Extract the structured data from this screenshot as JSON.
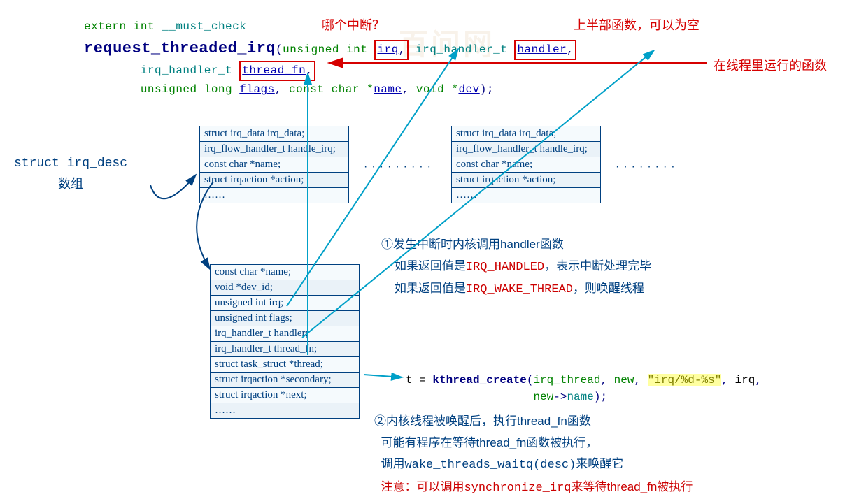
{
  "annotations": {
    "which_irq": "哪个中断？",
    "top_half": "上半部函数，可以为空",
    "thread_run": "在线程里运行的函数"
  },
  "signature": {
    "extern": "extern int",
    "must_check": "__must_check",
    "fn": "request_threaded_irq",
    "p_uint": "unsigned int",
    "p_irq": "irq",
    "p_handler_t": "irq_handler_t",
    "p_handler": "handler",
    "p_thread_fn": "thread_fn",
    "p_ulong": "unsigned long",
    "p_flags": "flags",
    "p_constchar": "const char *",
    "p_name": "name",
    "p_void": "void *",
    "p_dev": "dev"
  },
  "struct_label_line1": "struct irq_desc",
  "struct_label_line2": "数组",
  "table_irq_desc": [
    "struct irq_data irq_data;",
    "irq_flow_handler_t handle_irq;",
    "const char *name;",
    "struct irqaction *action;",
    "……"
  ],
  "table_irq_desc2": [
    "struct irq_data irq_data;",
    "irq_flow_handler_t handle_irq;",
    "const char *name;",
    "struct irqaction *action;",
    "……"
  ],
  "table_action": [
    "const char *name;",
    "void *dev_id;",
    "unsigned int irq;",
    "unsigned int flags;",
    "irq_handler_t handler;",
    "irq_handler_t thread_fn;",
    "struct task_struct *thread;",
    "struct irqaction *secondary;",
    "struct irqaction *next;",
    "……"
  ],
  "explain1": {
    "l1a": "①发生中断时内核调用",
    "l1b": "handler",
    "l1c": "函数",
    "l2a": "如果返回值是",
    "l2_irq_handled": "IRQ_HANDLED",
    "l2b": "，表示中断处理完毕",
    "l3a": "如果返回值是",
    "l3_wake": "IRQ_WAKE_THREAD",
    "l3b": "，则唤醒线程"
  },
  "code_line": {
    "t_eq": "t = ",
    "kthread": "kthread_create",
    "lp": "(",
    "irq_thread": "irq_thread",
    "c1": ", ",
    "new1": "new",
    "c2": ", ",
    "fmt": "\"irq/%d-%s\"",
    "c3": ", ",
    "irq": "irq",
    "c4": ",",
    "new2": "new",
    "arrow": "->",
    "name": "name",
    "rp": ");"
  },
  "explain2": {
    "l1a": "②内核线程被唤醒后，执行",
    "l1b": "thread_fn",
    "l1c": "函数",
    "l2a": "可能有程序在等待",
    "l2b": "thread_fn",
    "l2c": "函数被执行，",
    "l3a": "调用",
    "l3b": "wake_threads_waitq(desc)",
    "l3c": "来唤醒它",
    "l4a": "注意：",
    "l4b": "可以调用",
    "l4c": "synchronize_irq",
    "l4d": "来等待",
    "l4e": "thread_fn",
    "l4f": "被执行"
  },
  "watermark": "百问网"
}
